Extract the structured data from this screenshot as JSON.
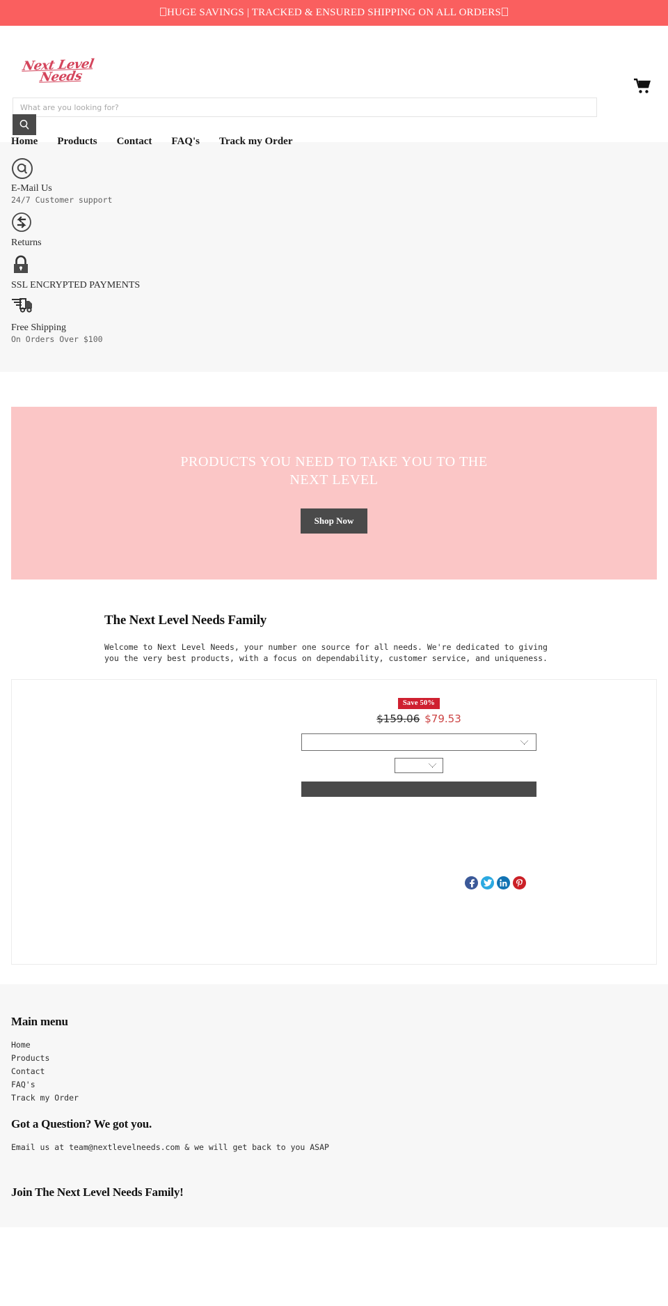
{
  "announcement": {
    "text": "HUGE SAVINGS | TRACKED & ENSURED SHIPPING ON ALL ORDERS",
    "bg_color": "#fa5f5f",
    "has_leading_emoji": true,
    "has_trailing_emoji": true
  },
  "header": {
    "logo_line1": "Next Level",
    "logo_line2": "Needs",
    "logo_color": "#d4455c",
    "cart_icon": "shopping-cart-icon",
    "search": {
      "placeholder": "What are you looking for?",
      "value": "",
      "button_icon": "search-icon"
    }
  },
  "nav": {
    "items": [
      {
        "label": "Home"
      },
      {
        "label": "Products"
      },
      {
        "label": "Contact"
      },
      {
        "label": "FAQ's"
      },
      {
        "label": "Track my Order"
      }
    ]
  },
  "features": [
    {
      "icon": "at-sign-icon",
      "title": "E-Mail Us",
      "sub": "24/7 Customer support"
    },
    {
      "icon": "returns-arrows-icon",
      "title": "Returns",
      "sub": ""
    },
    {
      "icon": "lock-icon",
      "title": "SSL ENCRYPTED PAYMENTS",
      "sub": ""
    },
    {
      "icon": "delivery-truck-icon",
      "title": "Free Shipping",
      "sub": "On Orders Over $100"
    }
  ],
  "hero": {
    "title": "PRODUCTS YOU NEED TO TAKE YOU TO THE NEXT LEVEL",
    "button_label": "Shop Now",
    "bg_color": "#fbc6c6"
  },
  "about": {
    "heading": "The Next Level Needs Family",
    "body": "Welcome to Next Level Needs, your number one source for all needs. We're dedicated to giving you the very best products, with a focus on dependability, customer service, and uniqueness."
  },
  "product": {
    "save_badge": "Save 50%",
    "price_old": "$159.06",
    "price_new": "$79.53",
    "badge_color": "#cf2030",
    "price_new_color": "#cc4444",
    "variant_select_value": "",
    "quantity_select_value": "",
    "add_to_cart_label": "",
    "share_icons": [
      {
        "name": "facebook-share-icon",
        "glyph": "f",
        "color": "#3b5998"
      },
      {
        "name": "twitter-share-icon",
        "glyph": "ᴠ",
        "color": "#2ba9e1"
      },
      {
        "name": "linkedin-share-icon",
        "glyph": "in",
        "color": "#1273b3"
      },
      {
        "name": "pinterest-share-icon",
        "glyph": "Ⓟ",
        "color": "#cb2027"
      }
    ]
  },
  "footer": {
    "main_menu_heading": "Main menu",
    "main_menu_items": [
      {
        "label": "Home"
      },
      {
        "label": "Products"
      },
      {
        "label": "Contact"
      },
      {
        "label": "FAQ's"
      },
      {
        "label": "Track my Order"
      }
    ],
    "question_heading": "Got a Question? We got you.",
    "question_text": "Email us at team@nextlevelneeds.com & we will get back to you ASAP",
    "join_heading": "Join The Next Level Needs Family!"
  }
}
